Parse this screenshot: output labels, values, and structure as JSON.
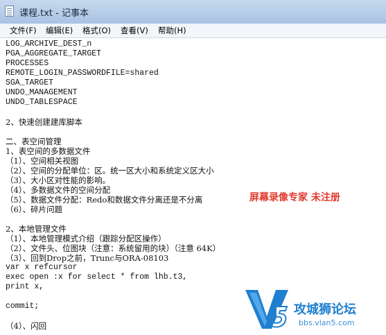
{
  "window": {
    "title": "课程.txt - 记事本"
  },
  "menu": [
    "文件(F)",
    "编辑(E)",
    "格式(O)",
    "查看(V)",
    "帮助(H)"
  ],
  "lines": [
    "LOG_ARCHIVE_DEST_n",
    "PGA_AGGREGATE_TARGET",
    "PROCESSES",
    "REMOTE_LOGIN_PASSWORDFILE=shared",
    "SGA_TARGET",
    "UNDO_MANAGEMENT",
    "UNDO_TABLESPACE",
    "",
    "2、快速创建建库脚本",
    "",
    "二、表空间管理",
    "1、表空间的多数据文件",
    "（1）、空间相关视图",
    "（2）、空间的分配单位：区。统一区大小和系统定义区大小",
    "（3）、大小区对性能的影响。",
    "（4）、多数据文件的空间分配",
    "（5）、数据文件分配：Redo和数据文件分离还是不分离",
    "（6）、碎片问题",
    "",
    "2、本地管理文件",
    "（1）、本地管理模式介绍（跟踪分配区操作）",
    "（2）、文件头、位图块（注意：系统留用的块）（注意 64K）",
    "（3）、回到Drop之前，Trunc与ORA-08103",
    "var x refcursor",
    "exec open :x for select * from lhb.t3,",
    "print x,",
    "",
    "commit;",
    "",
    "（4）、闪回"
  ],
  "watermark": {
    "recorder": "屏幕录像专家  未注册",
    "logo_text": "攻城狮论坛",
    "logo_url": "bbs.vlan5.com"
  },
  "colors": {
    "recorder_red": "#e23a2e",
    "logo_blue": "#1f7fcf"
  }
}
